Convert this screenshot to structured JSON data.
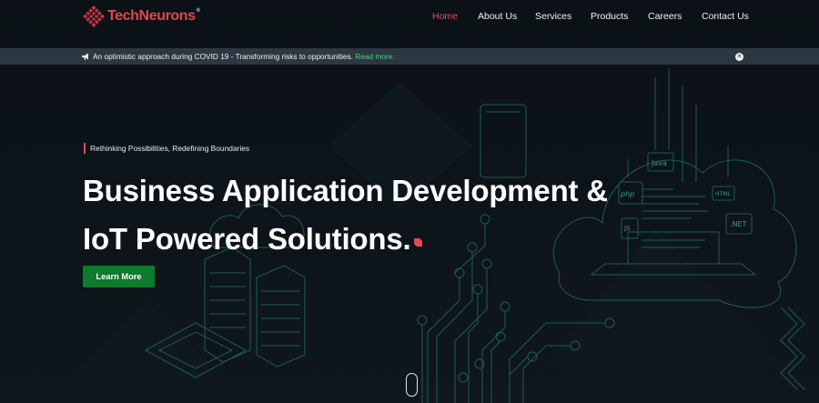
{
  "brand": {
    "name": "TechNeurons",
    "trademark": "®"
  },
  "nav": {
    "items": [
      {
        "label": "Home",
        "active": true
      },
      {
        "label": "About Us"
      },
      {
        "label": "Services"
      },
      {
        "label": "Products"
      },
      {
        "label": "Careers"
      },
      {
        "label": "Contact Us"
      }
    ]
  },
  "announcement": {
    "icon": "megaphone-icon",
    "text": "An optimistic approach during COVID 19 - Transforming risks to opportunities.",
    "link_label": "Read more.",
    "close_icon": "close-icon"
  },
  "hero": {
    "eyebrow": "Rethinking Possibilities, Redefining Boundaries",
    "headline_line1": "Business Application Development &",
    "headline_line2": "IoT Powered Solutions.",
    "cta_label": "Learn More",
    "illustration_labels": [
      "Java",
      "php",
      "HTML",
      "JS",
      ".NET"
    ]
  },
  "colors": {
    "background": "#0b1116",
    "accent_red": "#e34a54",
    "cta_green": "#0e7a2c",
    "announce_bg": "#2b3741",
    "link_green": "#4fd18a",
    "line_art": "#1f6b55"
  }
}
